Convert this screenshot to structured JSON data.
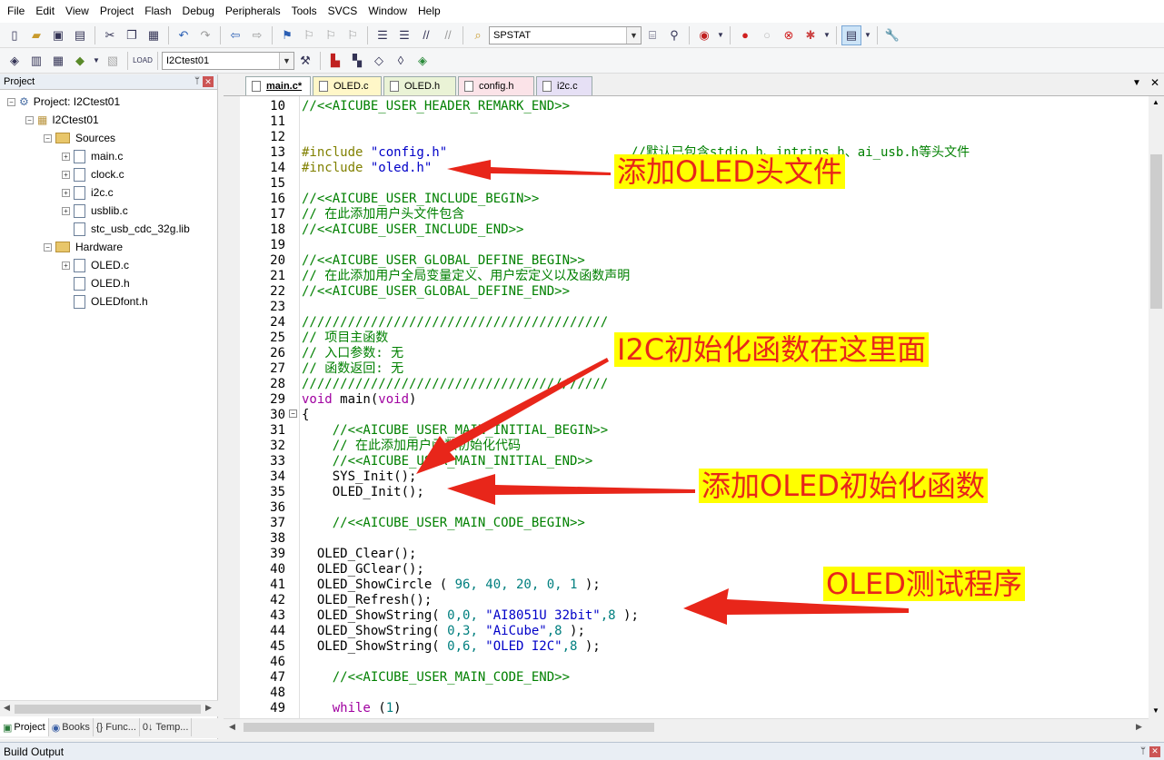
{
  "menu": [
    "File",
    "Edit",
    "View",
    "Project",
    "Flash",
    "Debug",
    "Peripherals",
    "Tools",
    "SVCS",
    "Window",
    "Help"
  ],
  "toolbar": {
    "find_combo_value": "SPSTAT",
    "target_combo_value": "I2Ctest01"
  },
  "project_panel": {
    "title": "Project",
    "tree": {
      "project": "Project: I2Ctest01",
      "target": "I2Ctest01",
      "groups": [
        {
          "name": "Sources",
          "files": [
            "main.c",
            "clock.c",
            "i2c.c",
            "usblib.c",
            "stc_usb_cdc_32g.lib"
          ]
        },
        {
          "name": "Hardware",
          "files": [
            "OLED.c",
            "OLED.h",
            "OLEDfont.h"
          ]
        }
      ]
    },
    "tabs": [
      "Project",
      "Books",
      "{} Func...",
      "0↓ Temp..."
    ]
  },
  "editor_tabs": [
    {
      "label": "main.c*",
      "color": "#ffffff",
      "active": true
    },
    {
      "label": "OLED.c",
      "color": "#fff7c8"
    },
    {
      "label": "OLED.h",
      "color": "#eaf3d6"
    },
    {
      "label": "config.h",
      "color": "#fbe3e8"
    },
    {
      "label": "i2c.c",
      "color": "#e6e0f5"
    }
  ],
  "code": {
    "line_numbers": [
      "10",
      "11",
      "12",
      "13",
      "14",
      "15",
      "16",
      "17",
      "18",
      "19",
      "20",
      "21",
      "22",
      "23",
      "24",
      "25",
      "26",
      "27",
      "28",
      "29",
      "30",
      "31",
      "32",
      "33",
      "34",
      "35",
      "36",
      "37",
      "38",
      "39",
      "40",
      "41",
      "42",
      "43",
      "44",
      "45",
      "46",
      "47",
      "48",
      "49"
    ],
    "lines": {
      "l10": "//<<AICUBE_USER_HEADER_REMARK_END>>",
      "l13_pre": "#include ",
      "l13_str": "\"config.h\"",
      "l13_com": "//默认已包含stdio.h、intrins.h、ai_usb.h等头文件",
      "l14_pre": "#include ",
      "l14_str": "\"oled.h\"",
      "l16": "//<<AICUBE_USER_INCLUDE_BEGIN>>",
      "l17": "// 在此添加用户头文件包含",
      "l18": "//<<AICUBE_USER_INCLUDE_END>>",
      "l20": "//<<AICUBE_USER_GLOBAL_DEFINE_BEGIN>>",
      "l21": "// 在此添加用户全局变量定义、用户宏定义以及函数声明",
      "l22": "//<<AICUBE_USER_GLOBAL_DEFINE_END>>",
      "l24": "////////////////////////////////////////",
      "l25": "// 项目主函数",
      "l26": "// 入口参数: 无",
      "l27": "// 函数返回: 无",
      "l28": "////////////////////////////////////////",
      "l29_kw": "void",
      "l29_mid": " main(",
      "l29_kw2": "void",
      "l29_end": ")",
      "l30": "{",
      "l31": "    //<<AICUBE_USER_MAIN_INITIAL_BEGIN>>",
      "l32": "    // 在此添加用户函数初始化代码",
      "l33": "    //<<AICUBE_USER_MAIN_INITIAL_END>>",
      "l34": "    SYS_Init();",
      "l35": "    OLED_Init();",
      "l37": "    //<<AICUBE_USER_MAIN_CODE_BEGIN>>",
      "l39": "  OLED_Clear();",
      "l40": "  OLED_GClear();",
      "l41_a": "  OLED_ShowCircle ( ",
      "l41_n": "96, 40, 20, 0, 1",
      "l41_b": " );",
      "l42": "  OLED_Refresh();",
      "l43_a": "  OLED_ShowString( ",
      "l43_n": "0,0,",
      "l43_s": " \"AI8051U 32bit\"",
      "l43_n2": ",8",
      "l43_b": " );",
      "l44_a": "  OLED_ShowString( ",
      "l44_n": "0,3,",
      "l44_s": " \"AiCube\"",
      "l44_n2": ",8",
      "l44_b": " );",
      "l45_a": "  OLED_ShowString( ",
      "l45_n": "0,6,",
      "l45_s": " \"OLED I2C\"",
      "l45_n2": ",8",
      "l45_b": " );",
      "l47": "    //<<AICUBE_USER_MAIN_CODE_END>>",
      "l49_kw": "    while",
      "l49_a": " (",
      "l49_n": "1",
      "l49_b": ")"
    }
  },
  "annotations": {
    "add_header": "添加OLED头文件",
    "i2c_init": "I2C初始化函数在这里面",
    "add_init": "添加OLED初始化函数",
    "test": "OLED测试程序"
  },
  "build_output": {
    "title": "Build Output"
  },
  "colors": {
    "annotation_text": "#e8261a",
    "annotation_bg": "#ffff00",
    "arrow": "#e8261a"
  }
}
